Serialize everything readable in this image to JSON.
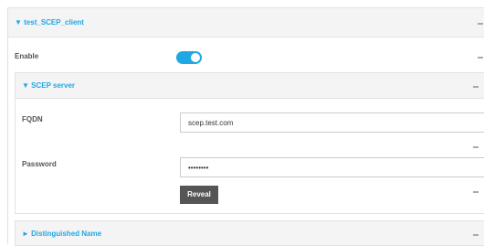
{
  "client": {
    "title": "▼ test_SCEP_client"
  },
  "enable": {
    "label": "Enable",
    "checked": true,
    "accent_color": "#1fa8e4"
  },
  "scep_server": {
    "title": "▼ SCEP server",
    "fqdn_label": "FQDN",
    "fqdn_value": "scep.test.com",
    "password_label": "Password",
    "password_value": "••••••••",
    "reveal_label": "Reveal"
  },
  "distinguished_name": {
    "title": "► Distinguished Name"
  },
  "icons": {
    "collapse": "minus-icon"
  }
}
